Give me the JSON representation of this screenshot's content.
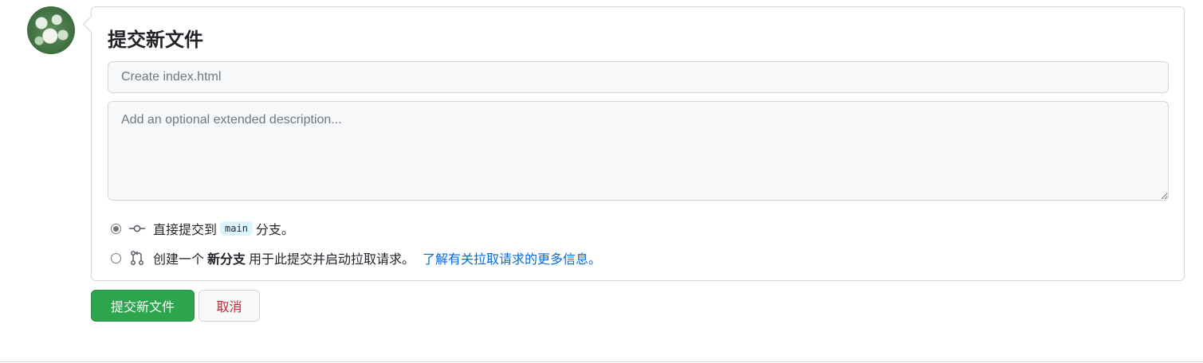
{
  "form": {
    "title": "提交新文件",
    "summary_placeholder": "Create index.html",
    "summary_value": "",
    "description_placeholder": "Add an optional extended description...",
    "description_value": ""
  },
  "options": {
    "direct": {
      "selected": true,
      "icon": "git-commit-icon",
      "prefix": "直接提交到",
      "branch": "main",
      "suffix": "分支。"
    },
    "new_branch": {
      "selected": false,
      "icon": "git-pull-request-icon",
      "prefix": "创建一个",
      "bold": "新分支",
      "suffix": "用于此提交并启动拉取请求。",
      "link": "了解有关拉取请求的更多信息。"
    }
  },
  "buttons": {
    "commit_label": "提交新文件",
    "cancel_label": "取消"
  },
  "colors": {
    "primary": "#2da44e",
    "cancel_text": "#cf222e",
    "link": "#0969da",
    "branch_bg": "#ddf4ff"
  }
}
